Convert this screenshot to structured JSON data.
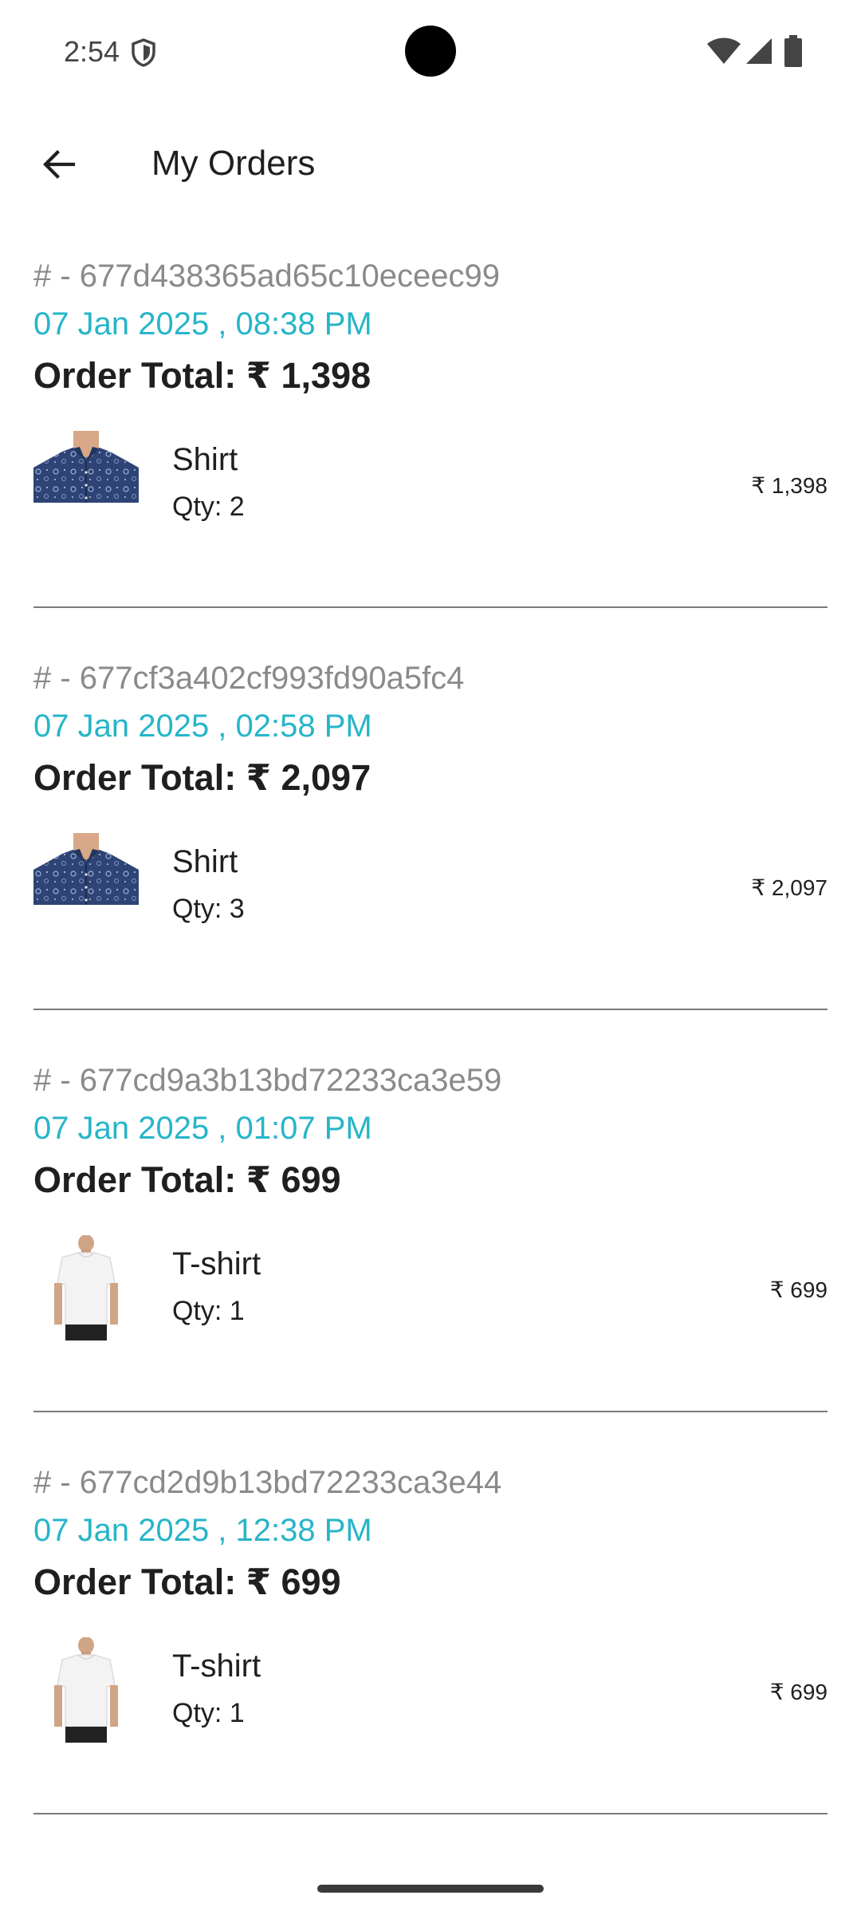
{
  "status_bar": {
    "time": "2:54",
    "icons": [
      "shield-icon",
      "wifi-icon",
      "signal-icon",
      "battery-icon"
    ]
  },
  "app_bar": {
    "back_icon": "arrow-back-icon",
    "title": "My Orders"
  },
  "colors": {
    "accent": "#26b5c9",
    "order_id": "#8a8a8a",
    "divider": "#7a7a7a"
  },
  "orders": [
    {
      "id": "# - 677d438365ad65c10eceec99",
      "date": "07 Jan 2025 , 08:38 PM",
      "total": "Order Total:  ₹ 1,398",
      "item": {
        "kind": "shirt",
        "name": "Shirt",
        "qty": "Qty: 2",
        "price": "₹ 1,398"
      }
    },
    {
      "id": "# - 677cf3a402cf993fd90a5fc4",
      "date": "07 Jan 2025 , 02:58 PM",
      "total": "Order Total:  ₹ 2,097",
      "item": {
        "kind": "shirt",
        "name": "Shirt",
        "qty": "Qty: 3",
        "price": "₹ 2,097"
      }
    },
    {
      "id": "# - 677cd9a3b13bd72233ca3e59",
      "date": "07 Jan 2025 , 01:07 PM",
      "total": "Order Total:  ₹ 699",
      "item": {
        "kind": "tshirt",
        "name": "T-shirt",
        "qty": "Qty: 1",
        "price": "₹ 699"
      }
    },
    {
      "id": "# - 677cd2d9b13bd72233ca3e44",
      "date": "07 Jan 2025 , 12:38 PM",
      "total": "Order Total:  ₹ 699",
      "item": {
        "kind": "tshirt",
        "name": "T-shirt",
        "qty": "Qty: 1",
        "price": "₹ 699"
      }
    }
  ]
}
